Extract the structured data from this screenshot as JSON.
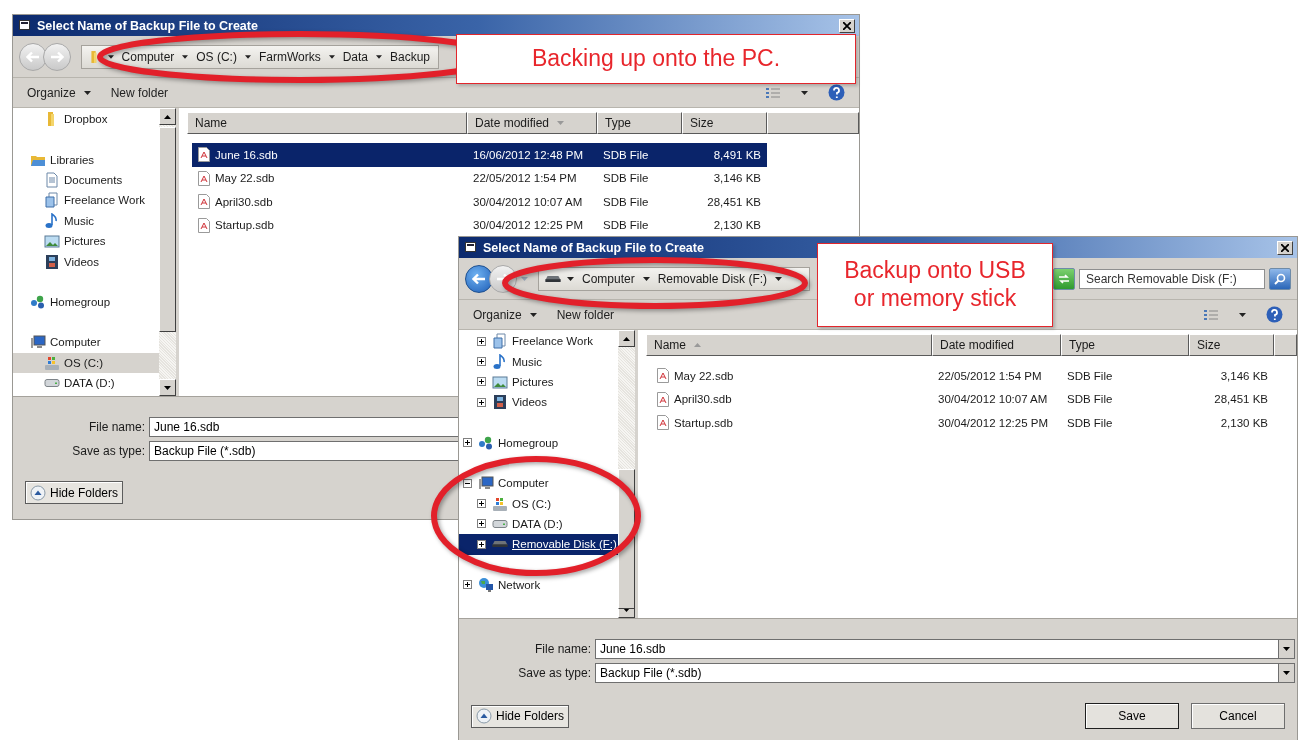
{
  "dialogs": [
    {
      "title": "Select Name of Backup File to Create",
      "back_enabled": false,
      "address": {
        "kind": "folder",
        "segments": [
          "Computer",
          "OS (C:)",
          "FarmWorks",
          "Data",
          "Backup"
        ]
      },
      "toolbar": {
        "organize": "Organize",
        "new_folder": "New folder"
      },
      "sidebar": {
        "focused": false,
        "items": [
          {
            "children": [
              {
                "label": "Dropbox",
                "kind": "folder",
                "selected": false
              }
            ]
          },
          {
            "label": "Libraries",
            "kind": "library",
            "selected": false,
            "children": [
              {
                "label": "Documents",
                "kind": "documents",
                "selected": false
              },
              {
                "label": "Freelance Work",
                "kind": "work",
                "selected": false
              },
              {
                "label": "Music",
                "kind": "music",
                "selected": false
              },
              {
                "label": "Pictures",
                "kind": "pictures",
                "selected": false
              },
              {
                "label": "Videos",
                "kind": "videos",
                "selected": false
              }
            ]
          },
          {
            "label": "Homegroup",
            "kind": "homegroup",
            "selected": false
          },
          {
            "label": "Computer",
            "kind": "computer",
            "selected": false,
            "children": [
              {
                "label": "OS (C:)",
                "kind": "system-drive",
                "selected": true
              },
              {
                "label": "DATA (D:)",
                "kind": "drive",
                "selected": false
              }
            ]
          }
        ]
      },
      "columns": [
        {
          "label": "Name",
          "sorted": false
        },
        {
          "label": "Date modified",
          "sorted": true,
          "descending": true
        },
        {
          "label": "Type",
          "sorted": false
        },
        {
          "label": "Size",
          "sorted": false
        }
      ],
      "files": [
        {
          "name": "June 16.sdb",
          "date": "16/06/2012 12:48 PM",
          "type": "SDB File",
          "size": "8,491 KB",
          "selected": true
        },
        {
          "name": "May 22.sdb",
          "date": "22/05/2012 1:54 PM",
          "type": "SDB File",
          "size": "3,146 KB",
          "selected": false
        },
        {
          "name": "April30.sdb",
          "date": "30/04/2012 10:07 AM",
          "type": "SDB File",
          "size": "28,451 KB",
          "selected": false
        },
        {
          "name": "Startup.sdb",
          "date": "30/04/2012 12:25 PM",
          "type": "SDB File",
          "size": "2,130 KB",
          "selected": false
        }
      ],
      "file_name_label": "File name:",
      "file_name": "June 16.sdb",
      "save_type_label": "Save as type:",
      "save_type": "Backup File (*.sdb)",
      "hide_folders": "Hide Folders"
    },
    {
      "title": "Select Name of Backup File to Create",
      "back_enabled": true,
      "address": {
        "kind": "removable",
        "segments": [
          "Computer",
          "Removable Disk (F:)"
        ],
        "dropdown": true
      },
      "search": {
        "placeholder": "Search Removable Disk (F:)"
      },
      "toolbar": {
        "organize": "Organize",
        "new_folder": "New folder"
      },
      "sidebar": {
        "focused": true,
        "items": [
          {
            "children": [
              {
                "label": "Freelance Work",
                "kind": "work",
                "selected": false,
                "expanded": false
              },
              {
                "label": "Music",
                "kind": "music",
                "selected": false,
                "expanded": false
              },
              {
                "label": "Pictures",
                "kind": "pictures",
                "selected": false,
                "expanded": false
              },
              {
                "label": "Videos",
                "kind": "videos",
                "selected": false,
                "expanded": false
              }
            ]
          },
          {
            "label": "Homegroup",
            "kind": "homegroup",
            "selected": false,
            "expanded": false
          },
          {
            "label": "Computer",
            "kind": "computer",
            "selected": false,
            "expanded": true,
            "children": [
              {
                "label": "OS (C:)",
                "kind": "system-drive",
                "selected": false,
                "expanded": false
              },
              {
                "label": "DATA (D:)",
                "kind": "drive",
                "selected": false,
                "expanded": false
              },
              {
                "label": "Removable Disk (F:)",
                "kind": "removable",
                "selected": true,
                "expanded": false
              }
            ]
          },
          {
            "label": "Network",
            "kind": "network",
            "selected": false,
            "expanded": false
          }
        ]
      },
      "columns": [
        {
          "label": "Name",
          "sorted": true,
          "descending": false
        },
        {
          "label": "Date modified",
          "sorted": false
        },
        {
          "label": "Type",
          "sorted": false
        },
        {
          "label": "Size",
          "sorted": false
        }
      ],
      "files": [
        {
          "name": "May 22.sdb",
          "date": "22/05/2012 1:54 PM",
          "type": "SDB File",
          "size": "3,146 KB",
          "selected": false
        },
        {
          "name": "April30.sdb",
          "date": "30/04/2012 10:07 AM",
          "type": "SDB File",
          "size": "28,451 KB",
          "selected": false
        },
        {
          "name": "Startup.sdb",
          "date": "30/04/2012 12:25 PM",
          "type": "SDB File",
          "size": "2,130 KB",
          "selected": false
        }
      ],
      "file_name_label": "File name:",
      "file_name": "June 16.sdb",
      "save_type_label": "Save as type:",
      "save_type": "Backup File (*.sdb)",
      "hide_folders": "Hide Folders",
      "buttons": [
        "Save",
        "Cancel"
      ]
    }
  ],
  "callouts": [
    {
      "text": "Backing up onto the PC."
    },
    {
      "text": "Backup onto USB or memory stick"
    }
  ]
}
